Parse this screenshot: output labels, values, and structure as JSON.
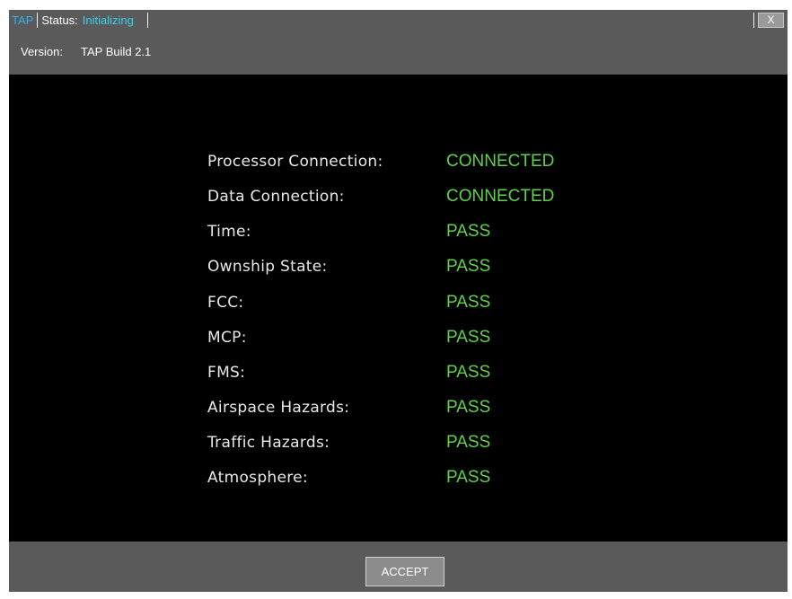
{
  "titlebar": {
    "app_tab": "TAP",
    "status_label": "Status:",
    "status_value": "Initializing",
    "close_label": "X"
  },
  "version": {
    "label": "Version:",
    "value": "TAP Build 2.1"
  },
  "checks": [
    {
      "name": "Processor Connection:",
      "result": "CONNECTED"
    },
    {
      "name": "Data Connection:",
      "result": "CONNECTED"
    },
    {
      "name": "Time:",
      "result": "PASS"
    },
    {
      "name": "Ownship State:",
      "result": "PASS"
    },
    {
      "name": "FCC:",
      "result": "PASS"
    },
    {
      "name": "MCP:",
      "result": "PASS"
    },
    {
      "name": "FMS:",
      "result": "PASS"
    },
    {
      "name": "Airspace Hazards:",
      "result": "PASS"
    },
    {
      "name": "Traffic Hazards:",
      "result": "PASS"
    },
    {
      "name": "Atmosphere:",
      "result": "PASS"
    }
  ],
  "footer": {
    "accept_label": "ACCEPT"
  },
  "colors": {
    "pass": "#5fd24a",
    "status_value": "#36d2e8",
    "app_tab": "#36b0e8",
    "panel": "#5a5a5a",
    "background": "#000000"
  }
}
